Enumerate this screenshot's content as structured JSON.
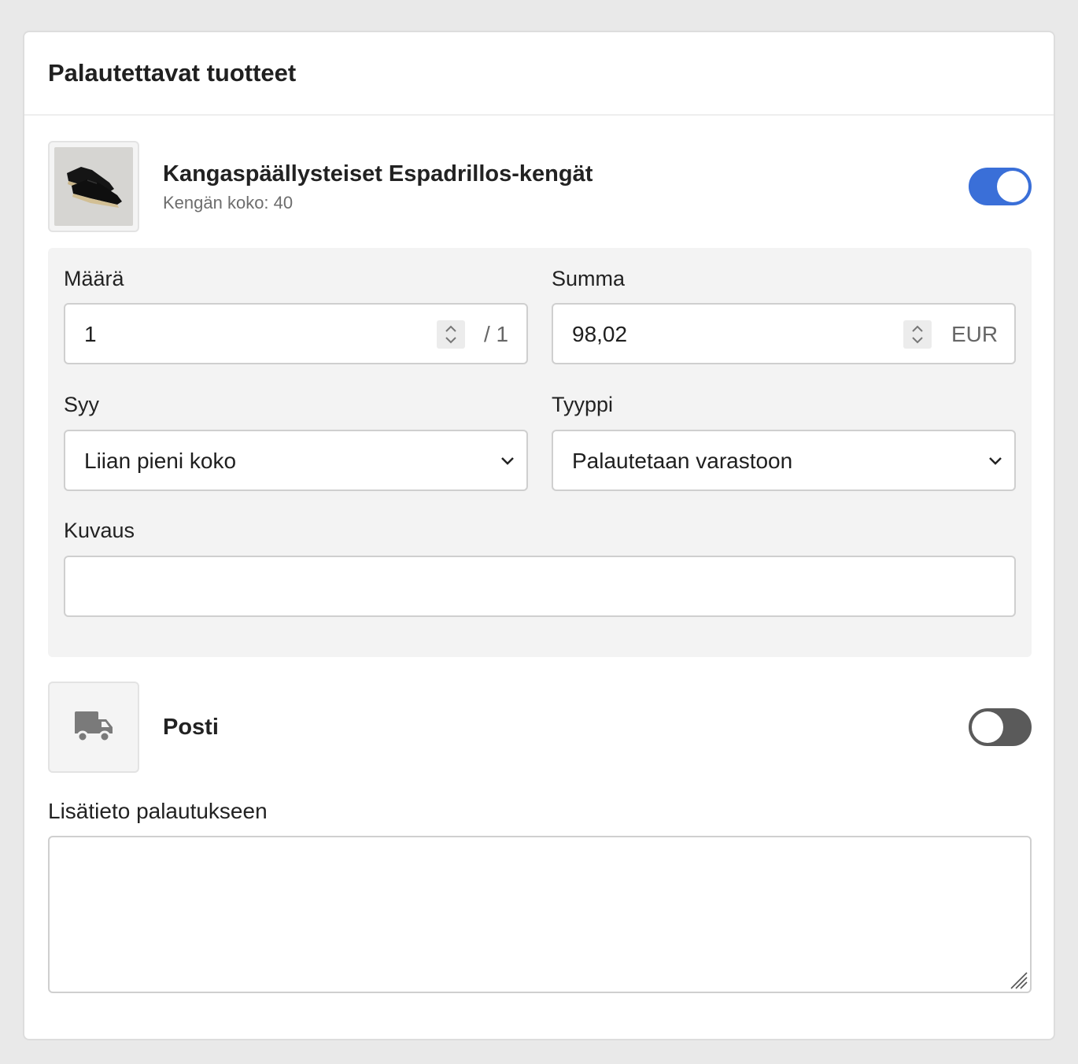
{
  "card": {
    "title": "Palautettavat tuotteet"
  },
  "product": {
    "name": "Kangaspäällysteiset Espadrillos-kengät",
    "variant": "Kengän koko: 40",
    "image_icon": "espadrille-shoes-image",
    "selected": true
  },
  "fields": {
    "quantity_label": "Määrä",
    "quantity_value": "1",
    "quantity_max": "/ 1",
    "amount_label": "Summa",
    "amount_value": "98,02",
    "currency": "EUR",
    "reason_label": "Syy",
    "reason_value": "Liian pieni koko",
    "type_label": "Tyyppi",
    "type_value": "Palautetaan varastoon",
    "description_label": "Kuvaus",
    "description_value": ""
  },
  "shipping": {
    "label": "Posti",
    "icon": "truck-icon",
    "enabled": false
  },
  "notes": {
    "label": "Lisätieto palautukseen",
    "value": ""
  },
  "colors": {
    "toggle_on": "#3a6fd8",
    "toggle_off": "#5a5a5a",
    "panel_bg": "#f3f3f3"
  }
}
